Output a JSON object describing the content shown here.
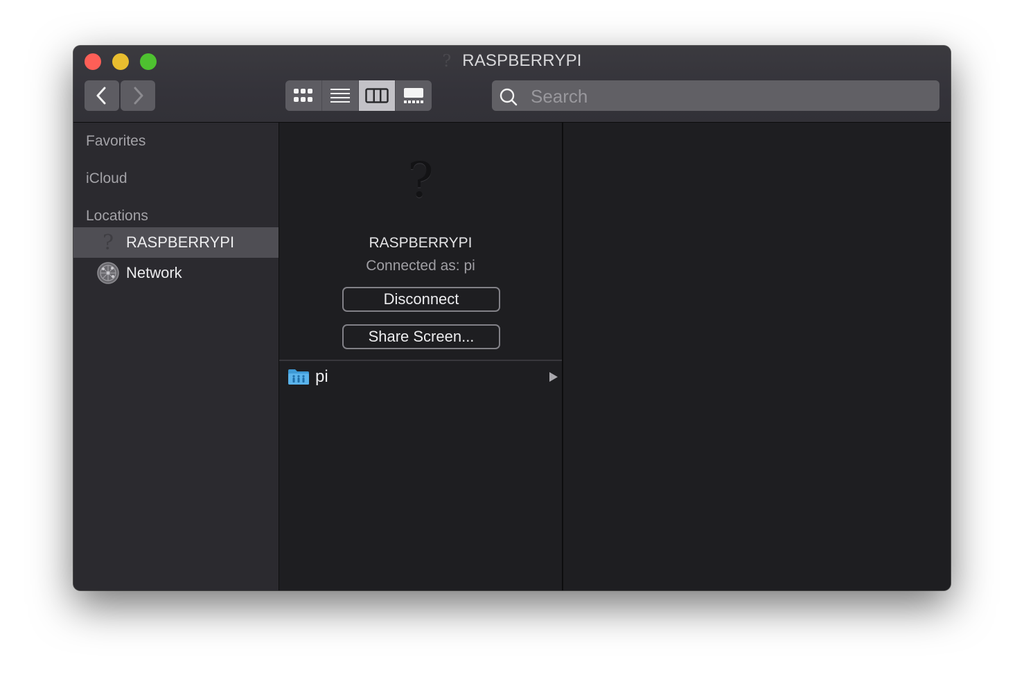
{
  "window": {
    "title": "RASPBERRYPI",
    "title_icon": "question-mark-icon"
  },
  "toolbar": {
    "back_icon": "chevron-left-icon",
    "forward_icon": "chevron-right-icon",
    "view_modes": [
      {
        "name": "icon-view",
        "icon": "grid-icon",
        "active": false
      },
      {
        "name": "list-view",
        "icon": "list-icon",
        "active": false
      },
      {
        "name": "column-view",
        "icon": "columns-icon",
        "active": true
      },
      {
        "name": "gallery-view",
        "icon": "gallery-icon",
        "active": false
      }
    ],
    "search": {
      "placeholder": "Search",
      "value": ""
    }
  },
  "sidebar": {
    "sections": [
      "Favorites",
      "iCloud",
      "Locations"
    ],
    "items": [
      {
        "label": "RASPBERRYPI",
        "icon": "question-mark-icon",
        "selected": true
      },
      {
        "label": "Network",
        "icon": "network-globe-icon",
        "selected": false
      }
    ]
  },
  "server": {
    "name": "RASPBERRYPI",
    "status": "Connected as: pi",
    "disconnect_label": "Disconnect",
    "share_screen_label": "Share Screen..."
  },
  "files": [
    {
      "name": "pi",
      "icon": "shared-folder-icon",
      "has_children": true
    }
  ]
}
